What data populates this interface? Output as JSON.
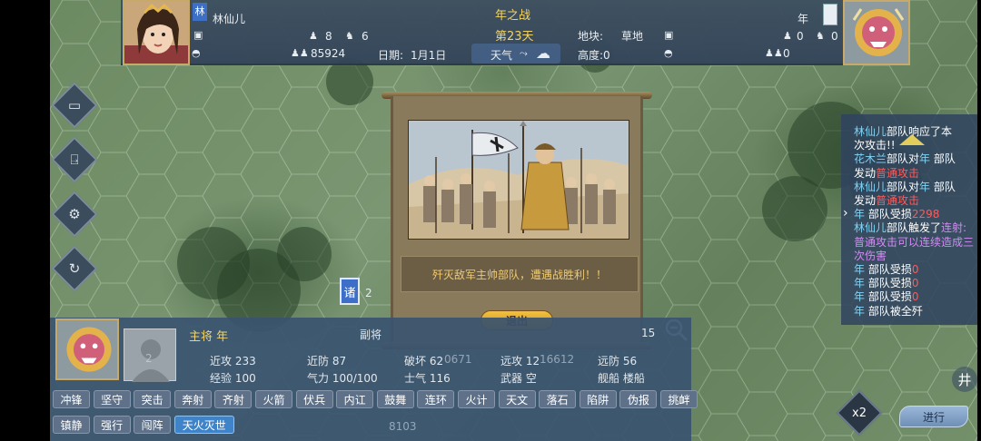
{
  "header": {
    "battle_title": "年之战",
    "day": "第23天",
    "left_general_badge": "林",
    "left_general_name": "林仙儿",
    "right_general_name": "年",
    "left_foot": "8",
    "left_horse": "6",
    "left_troops": "85924",
    "date_label": "日期:",
    "date_value": "1月1日",
    "weather_label": "天气",
    "terrain_label": "地块:",
    "terrain_value": "草地",
    "height_label": "高度:0",
    "right_foot": "0",
    "right_horse": "0",
    "right_troops": "0"
  },
  "dialog": {
    "message": "歼灭敌军主帅部队，遭遇战胜利！！",
    "exit_label": "退出"
  },
  "log": [
    [
      {
        "t": "林仙儿",
        "c": "b"
      },
      {
        "t": "部队响应了本",
        "c": "w"
      }
    ],
    [
      {
        "t": "次攻击!!",
        "c": "w"
      }
    ],
    [
      {
        "t": "花木兰",
        "c": "b"
      },
      {
        "t": "部队对",
        "c": "w"
      },
      {
        "t": "年",
        "c": "b"
      },
      {
        "t": " 部队",
        "c": "w"
      }
    ],
    [
      {
        "t": "发动",
        "c": "w"
      },
      {
        "t": "普通攻击",
        "c": "r"
      }
    ],
    [
      {
        "t": "林仙儿",
        "c": "b"
      },
      {
        "t": "部队对",
        "c": "w"
      },
      {
        "t": "年",
        "c": "b"
      },
      {
        "t": " 部队",
        "c": "w"
      }
    ],
    [
      {
        "t": "发动",
        "c": "w"
      },
      {
        "t": "普通攻击",
        "c": "r"
      }
    ],
    [
      {
        "t": "年",
        "c": "b"
      },
      {
        "t": " 部队受损",
        "c": "w"
      },
      {
        "t": "2298",
        "c": "r"
      }
    ],
    [
      {
        "t": "林仙儿",
        "c": "b"
      },
      {
        "t": "部队触发了",
        "c": "w"
      },
      {
        "t": "连射:",
        "c": "m"
      }
    ],
    [
      {
        "t": "普通攻击可以连续造成三",
        "c": "m"
      }
    ],
    [
      {
        "t": "次伤害",
        "c": "m"
      }
    ],
    [
      {
        "t": "年",
        "c": "b"
      },
      {
        "t": " 部队受损",
        "c": "w"
      },
      {
        "t": "0",
        "c": "r"
      }
    ],
    [
      {
        "t": "年",
        "c": "b"
      },
      {
        "t": " 部队受损",
        "c": "w"
      },
      {
        "t": "0",
        "c": "r"
      }
    ],
    [
      {
        "t": "年",
        "c": "b"
      },
      {
        "t": " 部队受损",
        "c": "w"
      },
      {
        "t": "0",
        "c": "r"
      }
    ],
    [
      {
        "t": "年",
        "c": "b"
      },
      {
        "t": " 部队被全歼",
        "c": "w"
      }
    ]
  ],
  "map_unit": {
    "badge": "诸",
    "count": "2"
  },
  "panel": {
    "commander_label": "主将 年",
    "deputy_label": "副将",
    "stats": {
      "melee_atk": "近攻 233",
      "melee_def": "近防 87",
      "destroy": "破坏 62",
      "range_atk": "远攻 12",
      "range_def": "远防 56",
      "exp": "经验 100",
      "strength": "气力 100/100",
      "morale": "士气 116",
      "weapon": "武器 空",
      "ship": "舰船 楼船"
    },
    "faded_numbers": [
      "0671",
      "16612",
      "15",
      "8103",
      "2"
    ],
    "skills_row1": [
      "冲锋",
      "坚守",
      "突击",
      "奔射",
      "齐射",
      "火箭",
      "伏兵",
      "内讧",
      "鼓舞",
      "连环",
      "火计",
      "天文",
      "落石",
      "陷阱",
      "伪报",
      "挑衅"
    ],
    "skills_row2": [
      "镇静",
      "强行",
      "闯阵",
      "天火灭世"
    ],
    "active_skill": "天火灭世"
  },
  "controls": {
    "speed_label": "x2",
    "proceed_label": "进行",
    "grid_icon_label": "井"
  },
  "colors": {
    "gold": "#f2d36b",
    "log_blue": "#7fd3f5",
    "log_red": "#ff5a5a",
    "log_magenta": "#d28cf3",
    "active_skill": "#3f84c8"
  },
  "icons": [
    "monitor-icon",
    "exit-door-icon",
    "gear-icon",
    "refresh-icon",
    "weather-cloud-icon",
    "zoom-out-icon",
    "grid-icon",
    "foot-soldier-icon",
    "cavalry-icon",
    "troops-icon",
    "ship-icon"
  ]
}
